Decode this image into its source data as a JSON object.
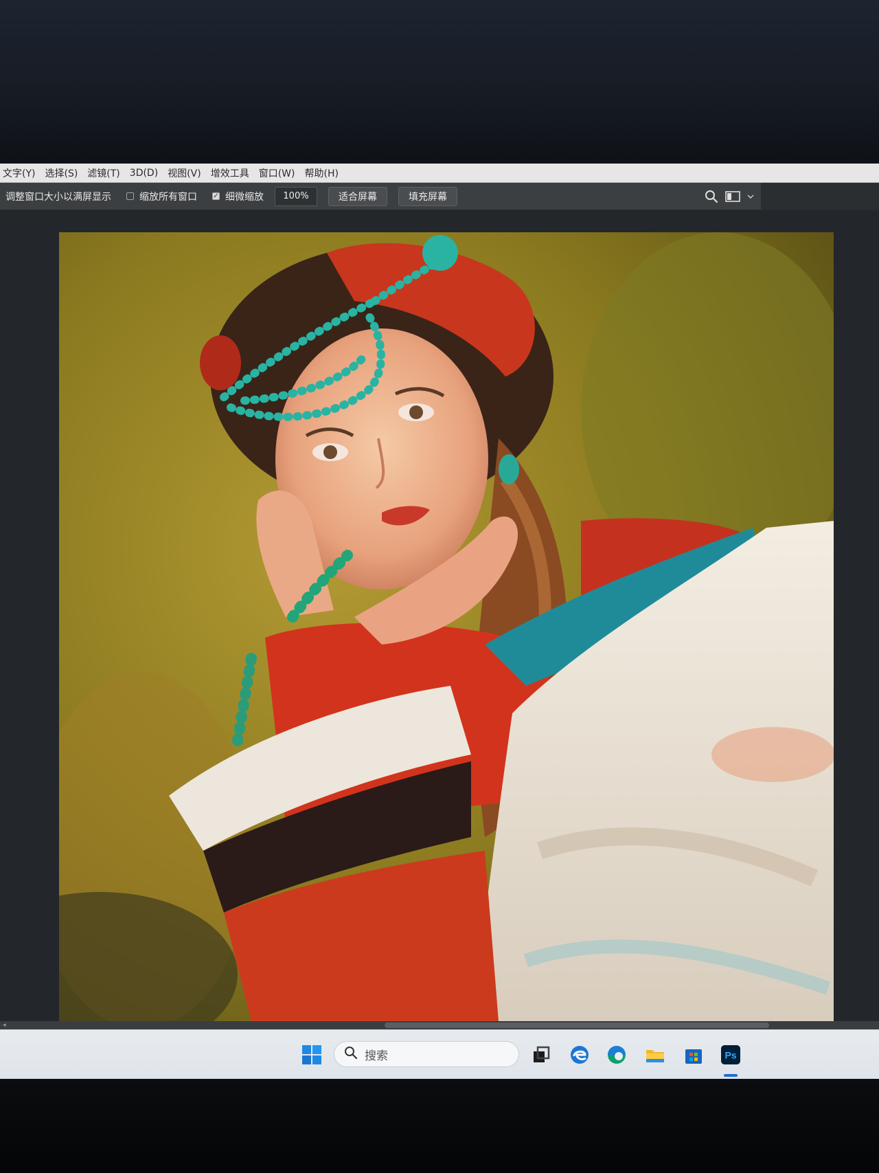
{
  "menu": {
    "items": [
      "文字(Y)",
      "选择(S)",
      "滤镜(T)",
      "3D(D)",
      "视图(V)",
      "增效工具",
      "窗口(W)",
      "帮助(H)"
    ]
  },
  "options": {
    "resize_windows_label": "调整窗口大小以满屏显示",
    "zoom_all_windows_label": "缩放所有窗口",
    "zoom_all_windows_checked": false,
    "scrubby_zoom_label": "细微缩放",
    "scrubby_zoom_checked": true,
    "zoom_value": "100%",
    "fit_screen_label": "适合屏幕",
    "fill_screen_label": "填充屏幕"
  },
  "taskbar": {
    "search_placeholder": "搜索",
    "apps": [
      "start-icon",
      "task-view-icon",
      "edge-legacy-icon",
      "edge-icon",
      "file-explorer-icon",
      "microsoft-store-icon",
      "photoshop-icon"
    ],
    "photoshop_label": "Ps",
    "accent_color": "#1f6fd1"
  },
  "icons": {
    "search": "search-icon",
    "workspace": "workspace-layout-icon",
    "dropdown": "chevron-down-icon"
  }
}
